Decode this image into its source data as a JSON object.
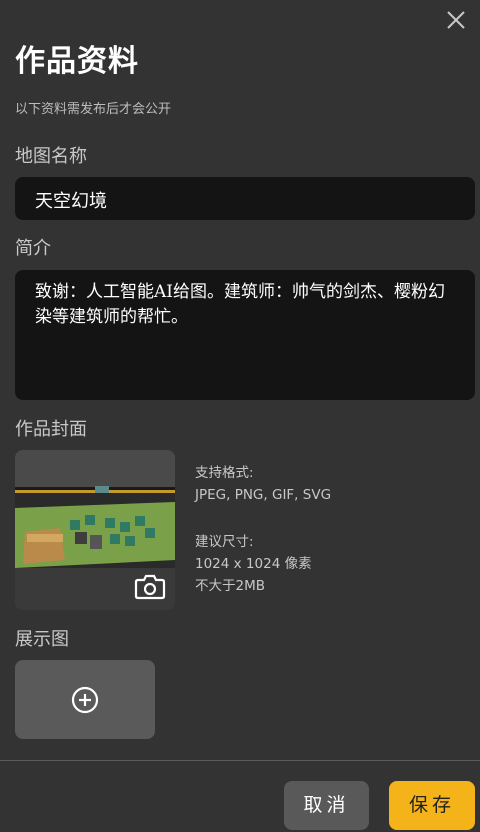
{
  "dialog": {
    "title": "作品资料",
    "subtitle": "以下资料需发布后才会公开"
  },
  "map_name": {
    "label": "地图名称",
    "value": "天空幻境"
  },
  "description": {
    "label": "简介",
    "value": "致谢：人工智能AI给图。建筑师：帅气的剑杰、樱粉幻染等建筑师的帮忙。"
  },
  "cover": {
    "label": "作品封面",
    "formats_label": "支持格式:",
    "formats_value": "JPEG, PNG, GIF, SVG",
    "size_label": "建议尺寸:",
    "size_value": "1024 x 1024 像素",
    "max_size": "不大于2MB"
  },
  "showcase": {
    "label": "展示图"
  },
  "buttons": {
    "cancel": "取消",
    "save": "保存"
  },
  "colors": {
    "background": "#333333",
    "input_background": "#141414",
    "accent": "#f3b319"
  }
}
